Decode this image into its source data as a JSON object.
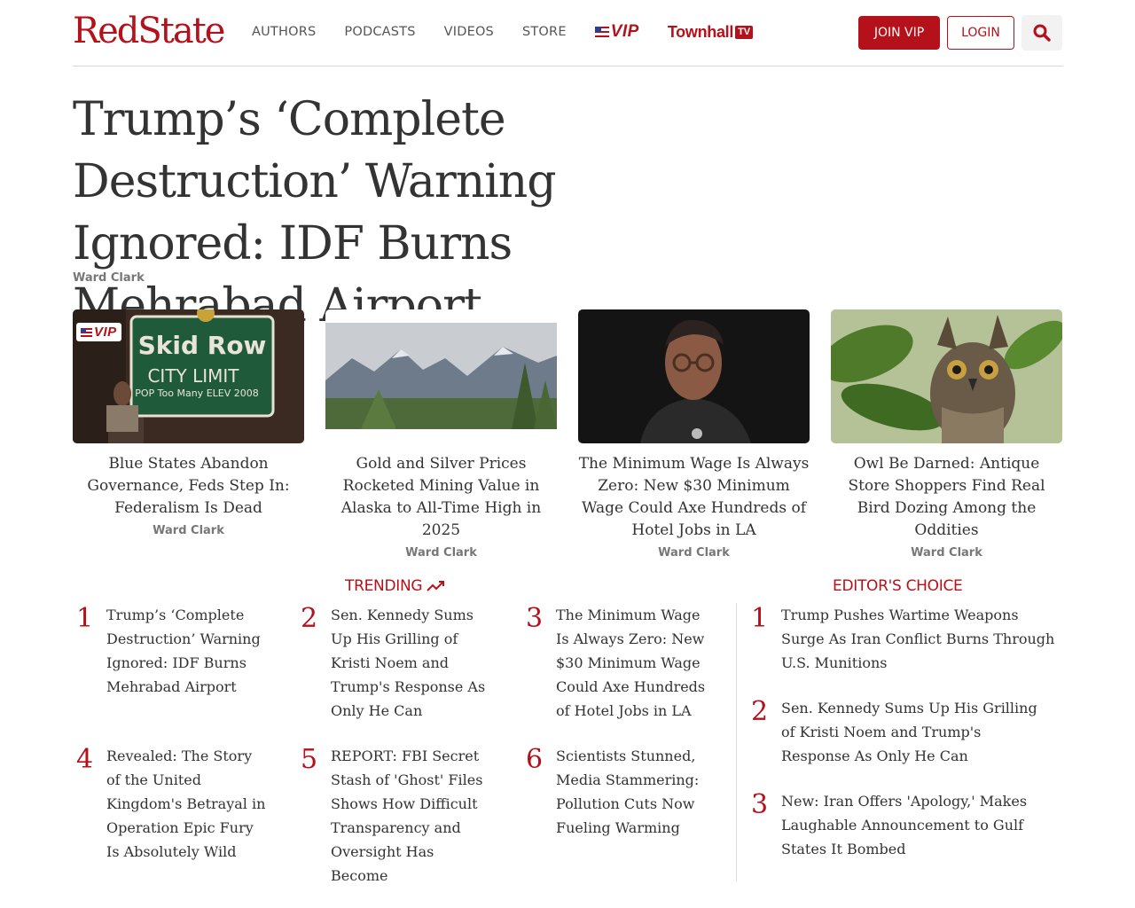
{
  "header": {
    "logo": "RedState",
    "nav": [
      "AUTHORS",
      "PODCASTS",
      "VIDEOS",
      "STORE"
    ],
    "vip_label": "VIP",
    "townhall_label": "Townhall",
    "tv_label": "TV",
    "join_label": "JOIN VIP",
    "login_label": "LOGIN"
  },
  "headline": {
    "title": "Trump’s ‘Complete Destruction’ Warning Ignored: IDF Burns Mehrabad Airport",
    "author": "Ward Clark"
  },
  "cards": [
    {
      "title": "Blue States Abandon Governance, Feds Step In: Federalism Is Dead",
      "author": "Ward Clark",
      "image": "skid-row-city-limit-sign",
      "sign_line1": "Skid Row",
      "sign_line2": "CITY LIMIT",
      "sign_line3": "POP Too Many    ELEV 2008",
      "vip": "VIP"
    },
    {
      "title": "Gold and Silver Prices Rocketed Mining Value in Alaska to All-Time High in 2025",
      "author": "Ward Clark",
      "image": "alaska-mountains"
    },
    {
      "title": "The Minimum Wage Is Always Zero: New $30 Minimum Wage Could Axe Hundreds of Hotel Jobs in LA",
      "author": "Ward Clark",
      "image": "woman-portrait"
    },
    {
      "title": "Owl Be Darned: Antique Store Shoppers Find Real Bird Dozing Among the Oddities",
      "author": "Ward Clark",
      "image": "owl"
    }
  ],
  "trending": {
    "title": "TRENDING",
    "items": [
      {
        "num": "1",
        "text": "Trump’s ‘Complete Destruction’ Warning Ignored: IDF Burns Mehrabad Airport"
      },
      {
        "num": "2",
        "text": "Sen. Kennedy Sums Up His Grilling of Kristi Noem and Trump's Response As Only He Can"
      },
      {
        "num": "3",
        "text": "The Minimum Wage Is Always Zero: New $30 Minimum Wage Could Axe Hundreds of Hotel Jobs in LA"
      },
      {
        "num": "4",
        "text": "Revealed: The Story of the United Kingdom's Betrayal in Operation Epic Fury Is Absolutely Wild"
      },
      {
        "num": "5",
        "text": "REPORT: FBI Secret Stash of 'Ghost' Files Shows How Difficult Transparency and Oversight Has Become"
      },
      {
        "num": "6",
        "text": "Scientists Stunned, Media Stammering: Pollution Cuts Now Fueling Warming"
      }
    ]
  },
  "editors_choice": {
    "title": "EDITOR'S CHOICE",
    "items": [
      {
        "num": "1",
        "text": "Trump Pushes Wartime Weapons Surge As Iran Conflict Burns Through U.S. Munitions"
      },
      {
        "num": "2",
        "text": "Sen. Kennedy Sums Up His Grilling of Kristi Noem and Trump's Response As Only He Can"
      },
      {
        "num": "3",
        "text": "New: Iran Offers 'Apology,' Makes Laughable Announcement to Gulf States It Bombed"
      }
    ]
  },
  "colors": {
    "brand_red": "#b5111b",
    "text": "#333333",
    "muted": "#777777"
  }
}
